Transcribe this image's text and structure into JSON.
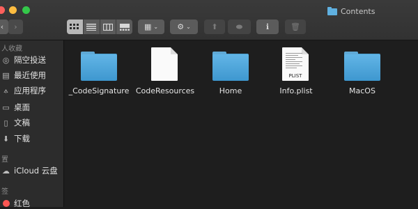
{
  "window": {
    "title": "Contents"
  },
  "toolbar": {
    "back_label": "‹",
    "forward_label": "›",
    "view_icons": [
      "icon-view-icon",
      "list-view-icon",
      "column-view-icon",
      "gallery-view-icon"
    ],
    "group_glyph": "▦",
    "action_glyph": "⚙",
    "share_glyph": "⬆",
    "tag_glyph": "⬬",
    "info_glyph": "ℹ",
    "trash_glyph": "🗑",
    "caret": "⌄"
  },
  "sidebar": {
    "section_favorites": "人收藏",
    "items": [
      {
        "label": "隔空投送",
        "icon": "airdrop-icon",
        "glyph": "◎"
      },
      {
        "label": "最近使用",
        "icon": "recents-icon",
        "glyph": "▤"
      },
      {
        "label": "应用程序",
        "icon": "applications-icon",
        "glyph": "⟑"
      },
      {
        "label": "桌面",
        "icon": "desktop-icon",
        "glyph": "▭"
      },
      {
        "label": "文稿",
        "icon": "documents-icon",
        "glyph": "▯"
      },
      {
        "label": "下载",
        "icon": "downloads-icon",
        "glyph": "⬇"
      }
    ],
    "section_locations": "置",
    "cloud_item": {
      "label": "iCloud 云盘",
      "icon": "icloud-icon",
      "glyph": "☁"
    },
    "section_tags": "签",
    "tag_item": {
      "label": "红色",
      "icon": "red-tag-icon",
      "color": "#fc5753"
    }
  },
  "files": [
    {
      "name": "_CodeSignature",
      "kind": "folder"
    },
    {
      "name": "CodeResources",
      "kind": "document"
    },
    {
      "name": "Home",
      "kind": "folder"
    },
    {
      "name": "Info.plist",
      "kind": "plist",
      "badge": "PLIST"
    },
    {
      "name": "MacOS",
      "kind": "folder"
    }
  ],
  "colors": {
    "folder": "#4aa3d8",
    "background": "#1e1e1e",
    "sidebar": "#2c2c2c"
  }
}
